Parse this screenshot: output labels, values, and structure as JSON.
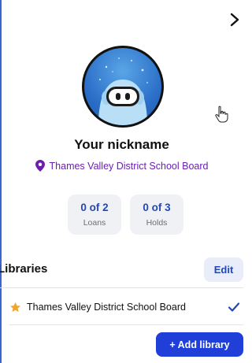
{
  "profile": {
    "nickname": "Your nickname",
    "district": "Thames Valley District School Board"
  },
  "stats": [
    {
      "count": "0 of 2",
      "label": "Loans"
    },
    {
      "count": "0 of 3",
      "label": "Holds"
    }
  ],
  "libraries": {
    "title": "Libraries",
    "edit_label": "Edit",
    "items": [
      {
        "name": "Thames Valley District School Board",
        "icon": "star-icon",
        "selected": true
      }
    ],
    "add_label": "+ Add library"
  },
  "icons": {
    "close": "chevron-right-icon",
    "location": "location-pin-icon",
    "check": "checkmark-icon",
    "cursor": "hand-pointer-icon"
  },
  "colors": {
    "accent_blue": "#2347b7",
    "button_blue": "#1f3fd8",
    "purple": "#6a1fb0",
    "star": "#f2a52d"
  }
}
